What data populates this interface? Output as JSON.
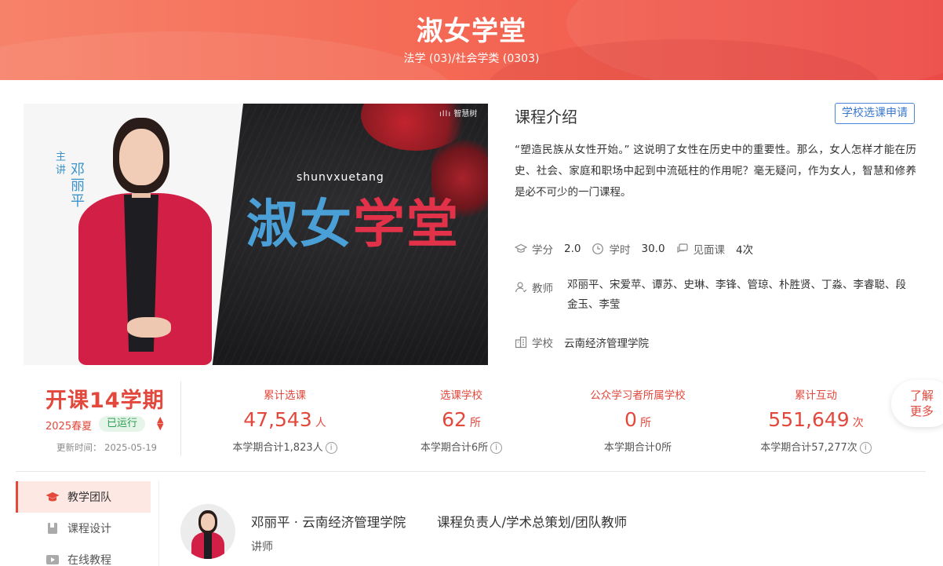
{
  "header": {
    "title": "淑女学堂",
    "subtitle": "法学 (03)/社会学类 (0303)"
  },
  "hero": {
    "brand": "智慧树",
    "label_zhujiang": "主讲",
    "teacher_name": "邓丽平",
    "english_title": "shunvxuetang",
    "big_title_1": "淑女",
    "big_title_2": "学堂"
  },
  "intro": {
    "title": "课程介绍",
    "apply_button": "学校选课申请",
    "description": "“塑造民族从女性开始。” 这说明了女性在历史中的重要性。那么，女人怎样才能在历史、社会、家庭和职场中起到中流砥柱的作用呢？毫无疑问，作为女人，智慧和修养是必不可少的一门课程。",
    "credit_label": "学分",
    "credit_value": "2.0",
    "hours_label": "学时",
    "hours_value": "30.0",
    "meeting_label": "见面课",
    "meeting_value": "4次",
    "teachers_label": "教师",
    "teachers_value": "邓丽平、宋爱苹、谭苏、史琳、李锋、管琼、朴胜贤、丁淼、李睿聪、段金玉、李莹",
    "school_label": "学校",
    "school_value": "云南经济管理学院"
  },
  "term": {
    "big": "开课14学期",
    "semester": "2025春夏",
    "status": "已运行",
    "updated": "更新时间： 2025-05-19"
  },
  "stats": [
    {
      "label": "累计选课",
      "value": "47,543",
      "unit": "人",
      "foot": "本学期合计1,823人"
    },
    {
      "label": "选课学校",
      "value": "62",
      "unit": "所",
      "foot": "本学期合计6所"
    },
    {
      "label": "公众学习者所属学校",
      "value": "0",
      "unit": "所",
      "foot": "本学期合计0所"
    },
    {
      "label": "累计互动",
      "value": "551,649",
      "unit": "次",
      "foot": "本学期合计57,277次"
    }
  ],
  "more_button": "了解更多",
  "side_menu": [
    {
      "label": "教学团队",
      "icon": "graduation-cap-icon",
      "active": true
    },
    {
      "label": "课程设计",
      "icon": "book-icon",
      "active": false
    },
    {
      "label": "在线教程",
      "icon": "video-icon",
      "active": false
    }
  ],
  "teacher_card": {
    "name": "邓丽平 · 云南经济管理学院",
    "role": "课程负责人/学术总策划/团队教师",
    "title": "讲师"
  },
  "colors": {
    "accent": "#e2483c",
    "banner_start": "#f7826a",
    "banner_end": "#ec4a46",
    "link_blue": "#3a78d0",
    "status_green": "#2d9e52"
  }
}
